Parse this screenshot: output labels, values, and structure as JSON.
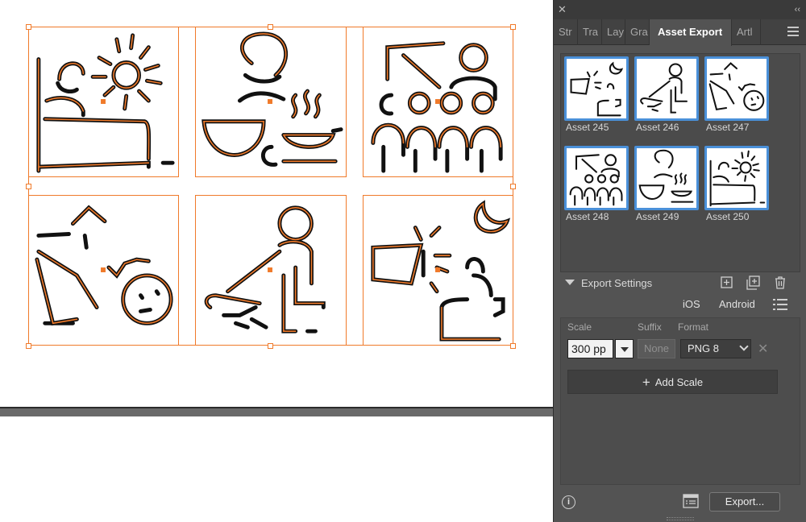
{
  "panel": {
    "close_glyph": "✕",
    "collapse_glyph": "‹‹",
    "tabs": [
      {
        "label": "Str"
      },
      {
        "label": "Tra"
      },
      {
        "label": "Lay"
      },
      {
        "label": "Gra"
      },
      {
        "label": "Asset Export",
        "active": true
      },
      {
        "label": "Artl"
      }
    ],
    "assets": [
      {
        "name": "Asset 245",
        "icon": "megaphone-moon-icon"
      },
      {
        "name": "Asset 246",
        "icon": "kneeling-person-icon"
      },
      {
        "name": "Asset 247",
        "icon": "fallen-person-icon"
      },
      {
        "name": "Asset 248",
        "icon": "classroom-icon"
      },
      {
        "name": "Asset 249",
        "icon": "cooking-bowl-icon"
      },
      {
        "name": "Asset 250",
        "icon": "sun-bed-icon"
      }
    ],
    "export_settings": {
      "label": "Export Settings",
      "platforms": {
        "ios": "iOS",
        "android": "Android"
      },
      "columns": {
        "scale": "Scale",
        "suffix": "Suffix",
        "format": "Format"
      },
      "scale_value": "300 pp",
      "suffix_placeholder": "None",
      "format_value": "PNG 8",
      "add_scale_label": "Add Scale"
    },
    "footer": {
      "info_glyph": "i",
      "export_label": "Export..."
    }
  },
  "colors": {
    "selection": "#f07a2a",
    "thumb_border": "#4a90d9",
    "panel_bg": "#535353"
  }
}
